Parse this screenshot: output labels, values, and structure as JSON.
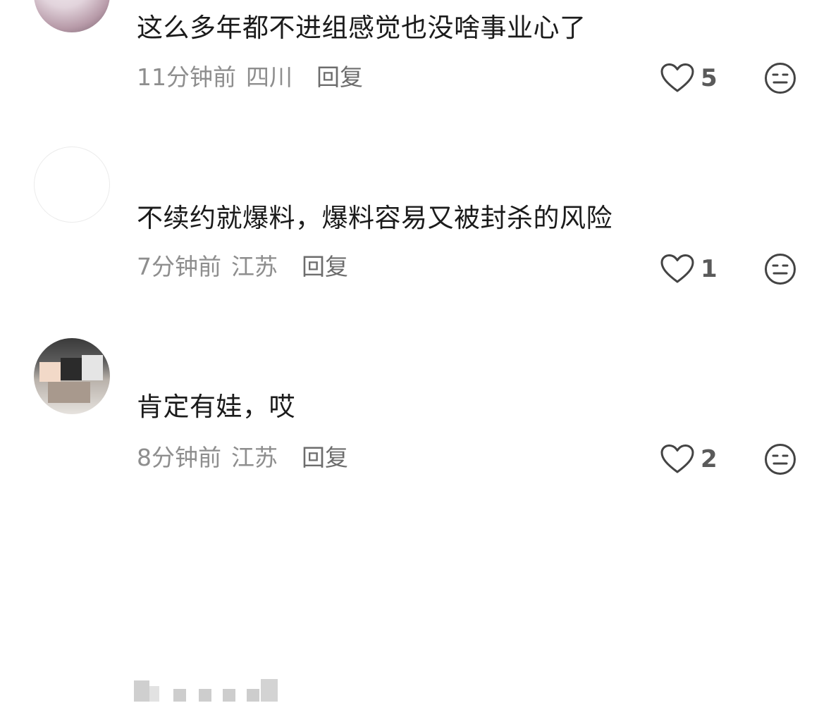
{
  "comments": [
    {
      "avatar": "avatar-image-anime",
      "text": "这么多年都不进组感觉也没啥事业心了",
      "time": "11分钟前",
      "location": "四川",
      "reply_label": "回复",
      "likes": "5"
    },
    {
      "avatar": "avatar-blank",
      "text": "不续约就爆料，爆料容易又被封杀的风险",
      "time": "7分钟前",
      "location": "江苏",
      "reply_label": "回复",
      "likes": "1"
    },
    {
      "avatar": "avatar-image-cat",
      "text": "肯定有娃，哎",
      "time": "8分钟前",
      "location": "江苏",
      "reply_label": "回复",
      "likes": "2"
    }
  ],
  "icons": {
    "like": "heart-outline-icon",
    "dislike": "meh-face-icon"
  },
  "colors": {
    "text": "#1b1b1b",
    "meta": "#8e8e8e",
    "icon": "#444444"
  }
}
